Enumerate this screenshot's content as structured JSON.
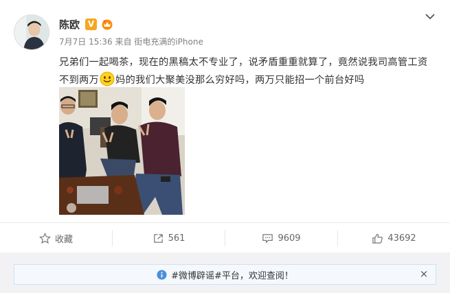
{
  "post": {
    "username": "陈欧",
    "verified_badge": "V",
    "meta": {
      "date": "7月7日 15:36",
      "from": "来自",
      "source": "街电充满的iPhone"
    },
    "text_part1": "兄弟们一起喝茶，现在的黑稿太不专业了，说矛盾重重就算了，竟然说我司高管工资不到两万",
    "emoji": "smile-emoji",
    "text_part2": "妈的我们大聚美没那么穷好吗，两万只能招一个前台好吗"
  },
  "actions": {
    "favorite_label": "收藏",
    "repost_count": "561",
    "comment_count": "9609",
    "like_count": "43692"
  },
  "notice": {
    "text": "#微博辟谣#平台，欢迎查阅！",
    "close": "×"
  },
  "icons": {
    "menu": "chevron-down-icon",
    "favorite": "star-icon",
    "repost": "share-icon",
    "comment": "comment-icon",
    "like": "thumbs-up-icon",
    "info": "info-icon"
  },
  "colors": {
    "verified": "#f5a623",
    "notice_bg": "#f5f9fd",
    "notice_border": "#cfe0f0",
    "info": "#4a90d9"
  }
}
